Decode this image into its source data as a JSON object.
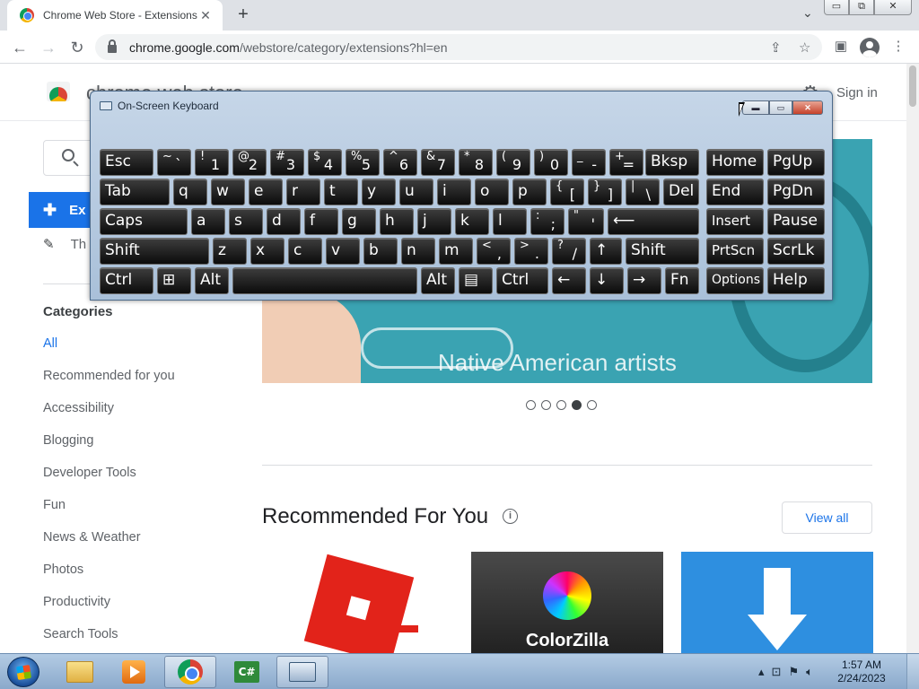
{
  "browser": {
    "tab_title": "Chrome Web Store - Extensions",
    "tab_close": "✕",
    "new_tab": "+",
    "tab_list": "⌄",
    "url_host": "chrome.google.com",
    "url_path": "/webstore/category/extensions?hl=en",
    "back": "←",
    "forward": "→",
    "reload": "↻",
    "window_caption": [
      "▭",
      "⧉",
      "✕"
    ]
  },
  "store": {
    "name": "chrome web store",
    "sign_in": "Sign in",
    "nav_extensions": "Ex",
    "nav_themes": "Th",
    "categories_title": "Categories",
    "categories": [
      "All",
      "Recommended for you",
      "Accessibility",
      "Blogging",
      "Developer Tools",
      "Fun",
      "News & Weather",
      "Photos",
      "Productivity",
      "Search Tools"
    ],
    "active_category": "All",
    "banner_text": "Native American artists",
    "carousel_slides": 5,
    "carousel_active": 4,
    "recommended_title": "Recommended For You",
    "info_glyph": "i",
    "view_all": "View all",
    "cards": [
      {
        "name": "Roblox"
      },
      {
        "name": "ColorZilla",
        "label": "ColorZilla"
      },
      {
        "name": "Download"
      }
    ]
  },
  "osk": {
    "title": "On-Screen Keyboard",
    "rows": [
      [
        "Esc",
        "~ `",
        "! 1",
        "@ 2",
        "# 3",
        "$ 4",
        "% 5",
        "^ 6",
        "& 7",
        "* 8",
        "( 9",
        ") 0",
        "_ -",
        "+ =",
        "Bksp",
        "Home",
        "PgUp"
      ],
      [
        "Tab",
        "q",
        "w",
        "e",
        "r",
        "t",
        "y",
        "u",
        "i",
        "o",
        "p",
        "{ [",
        "} ]",
        "| \\",
        "Del",
        "End",
        "PgDn"
      ],
      [
        "Caps",
        "a",
        "s",
        "d",
        "f",
        "g",
        "h",
        "j",
        "k",
        "l",
        ": ;",
        "\" '",
        "⟵",
        "Insert",
        "Pause"
      ],
      [
        "Shift",
        "z",
        "x",
        "c",
        "v",
        "b",
        "n",
        "m",
        "< ,",
        "> .",
        "? /",
        "↑",
        "Shift",
        "PrtScn",
        "ScrLk"
      ],
      [
        "Ctrl",
        "⊞",
        "Alt",
        "",
        "Alt",
        "▤",
        "Ctrl",
        "←",
        "↓",
        "→",
        "Fn",
        "Options",
        "Help"
      ]
    ]
  },
  "taskbar": {
    "time": "1:57 AM",
    "date": "2/24/2023",
    "apps": [
      "Windows Explorer",
      "Windows Media Player",
      "Google Chrome",
      "C#",
      "On-Screen Keyboard"
    ],
    "active_app": "On-Screen Keyboard",
    "cs_label": "C#"
  }
}
